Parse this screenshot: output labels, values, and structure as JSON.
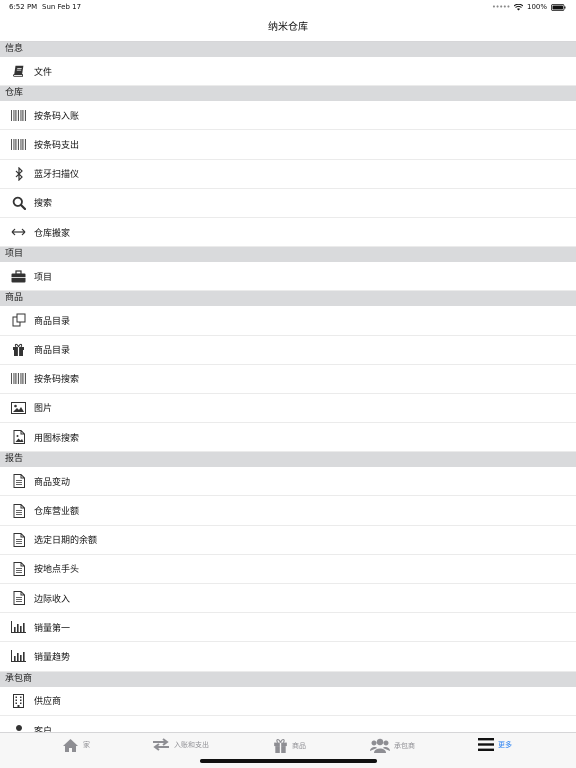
{
  "status": {
    "time": "6:52 PM",
    "date": "Sun Feb 17",
    "battery": "100%"
  },
  "nav": {
    "title": "纳米仓库"
  },
  "sections": [
    {
      "title": "信息",
      "items": [
        {
          "label": "文件",
          "icon": "book-icon"
        }
      ]
    },
    {
      "title": "仓库",
      "items": [
        {
          "label": "按条码入账",
          "icon": "barcode-icon"
        },
        {
          "label": "按条码支出",
          "icon": "barcode-icon"
        },
        {
          "label": "蓝牙扫描仪",
          "icon": "bluetooth-icon"
        },
        {
          "label": "搜索",
          "icon": "search-icon"
        },
        {
          "label": "仓库搬家",
          "icon": "arrows-horizontal-icon"
        }
      ]
    },
    {
      "title": "项目",
      "items": [
        {
          "label": "项目",
          "icon": "briefcase-icon"
        }
      ]
    },
    {
      "title": "商品",
      "items": [
        {
          "label": "商品目录",
          "icon": "copy-icon"
        },
        {
          "label": "商品目录",
          "icon": "gift-icon"
        },
        {
          "label": "按条码搜索",
          "icon": "barcode-icon"
        },
        {
          "label": "图片",
          "icon": "image-icon"
        },
        {
          "label": "用图标搜索",
          "icon": "image-file-icon"
        }
      ]
    },
    {
      "title": "报告",
      "items": [
        {
          "label": "商品变动",
          "icon": "document-icon"
        },
        {
          "label": "仓库营业额",
          "icon": "document-icon"
        },
        {
          "label": "选定日期的余额",
          "icon": "document-icon"
        },
        {
          "label": "按地点手头",
          "icon": "document-icon"
        },
        {
          "label": "边际收入",
          "icon": "document-icon"
        },
        {
          "label": "销量第一",
          "icon": "bar-chart-icon"
        },
        {
          "label": "销量趋势",
          "icon": "bar-chart-icon"
        }
      ]
    },
    {
      "title": "承包商",
      "items": [
        {
          "label": "供应商",
          "icon": "building-icon"
        },
        {
          "label": "客户",
          "icon": "user-icon"
        }
      ]
    }
  ],
  "tabs": [
    {
      "label": "家",
      "icon": "home-icon",
      "active": false
    },
    {
      "label": "入账和支出",
      "icon": "transfer-icon",
      "active": false
    },
    {
      "label": "商品",
      "icon": "gift-icon",
      "active": false
    },
    {
      "label": "承包商",
      "icon": "users-icon",
      "active": false
    },
    {
      "label": "更多",
      "icon": "menu-icon",
      "active": true
    }
  ],
  "colors": {
    "accent": "#1e7bf2",
    "section_bg": "#d9dadc",
    "tab_inactive": "#8e8e93"
  }
}
